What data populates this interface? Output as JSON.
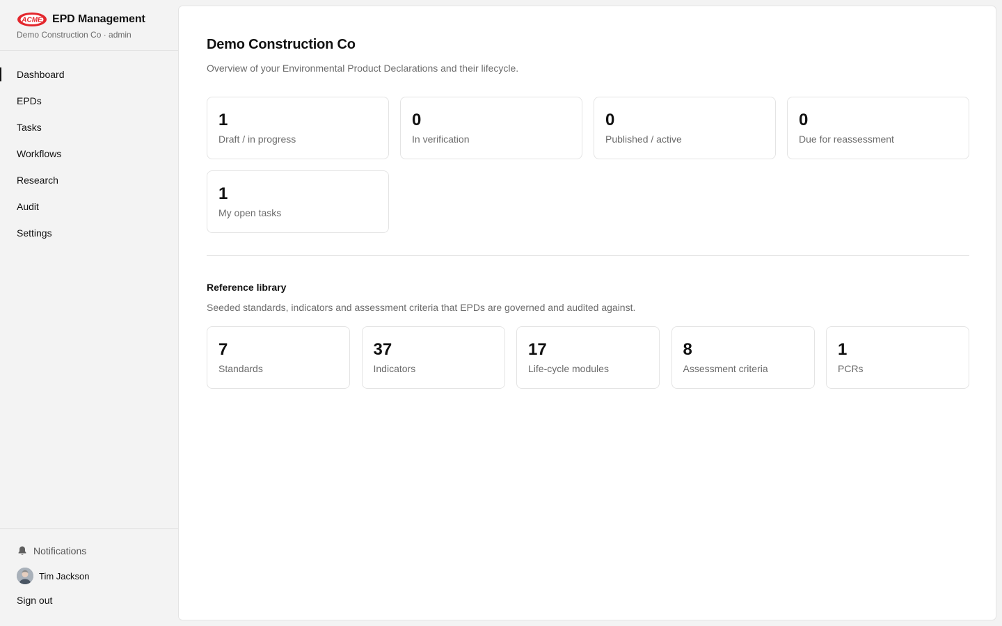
{
  "brand": {
    "logo_text": "ACME",
    "title": "EPD Management",
    "subtitle": "Demo Construction Co · admin"
  },
  "nav": {
    "items": [
      {
        "label": "Dashboard",
        "active": true
      },
      {
        "label": "EPDs",
        "active": false
      },
      {
        "label": "Tasks",
        "active": false
      },
      {
        "label": "Workflows",
        "active": false
      },
      {
        "label": "Research",
        "active": false
      },
      {
        "label": "Audit",
        "active": false
      },
      {
        "label": "Settings",
        "active": false
      }
    ]
  },
  "footer": {
    "notifications_label": "Notifications",
    "notifications_icon": "bell-icon",
    "user_name": "Tim Jackson",
    "sign_out_label": "Sign out"
  },
  "main": {
    "title": "Demo Construction Co",
    "subtitle": "Overview of your Environmental Product Declarations and their lifecycle.",
    "stats": [
      {
        "value": "1",
        "label": "Draft / in progress"
      },
      {
        "value": "0",
        "label": "In verification"
      },
      {
        "value": "0",
        "label": "Published / active"
      },
      {
        "value": "0",
        "label": "Due for reassessment"
      },
      {
        "value": "1",
        "label": "My open tasks"
      }
    ],
    "library": {
      "title": "Reference library",
      "subtitle": "Seeded standards, indicators and assessment criteria that EPDs are governed and audited against.",
      "cards": [
        {
          "value": "7",
          "label": "Standards"
        },
        {
          "value": "37",
          "label": "Indicators"
        },
        {
          "value": "17",
          "label": "Life-cycle modules"
        },
        {
          "value": "8",
          "label": "Assessment criteria"
        },
        {
          "value": "1",
          "label": "PCRs"
        }
      ]
    }
  },
  "colors": {
    "sidebar_bg": "#f3f3f3",
    "panel_bg": "#ffffff",
    "border": "#e4e4e4",
    "text": "#111111",
    "muted": "#6b6b6b",
    "logo_red": "#e3262c"
  }
}
